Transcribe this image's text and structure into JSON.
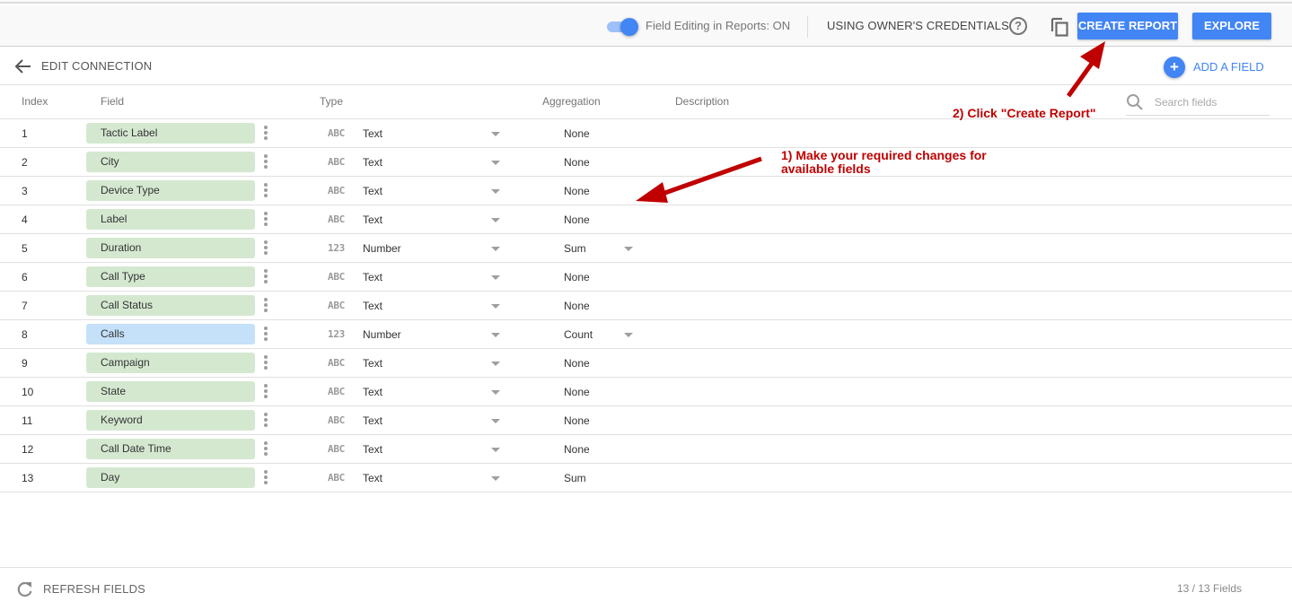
{
  "toolbar": {
    "field_editing_label": "Field Editing in Reports: ON",
    "field_editing_on": true,
    "credentials_label": "USING OWNER'S CREDENTIALS",
    "help_glyph": "?",
    "create_report_label": "CREATE REPORT",
    "explore_label": "EXPLORE"
  },
  "subheader": {
    "back_label": "EDIT CONNECTION",
    "add_field_glyph": "+",
    "add_field_label": "ADD A FIELD"
  },
  "table": {
    "headers": {
      "index": "Index",
      "field": "Field",
      "type": "Type",
      "aggregation": "Aggregation",
      "description": "Description"
    },
    "search_placeholder": "Search fields",
    "rows": [
      {
        "index": "1",
        "field": "Tactic Label",
        "kind": "dimension",
        "type_icon": "ABC",
        "type": "Text",
        "aggregation": "None",
        "agg_dropdown": false
      },
      {
        "index": "2",
        "field": "City",
        "kind": "dimension",
        "type_icon": "ABC",
        "type": "Text",
        "aggregation": "None",
        "agg_dropdown": false
      },
      {
        "index": "3",
        "field": "Device Type",
        "kind": "dimension",
        "type_icon": "ABC",
        "type": "Text",
        "aggregation": "None",
        "agg_dropdown": false
      },
      {
        "index": "4",
        "field": "Label",
        "kind": "dimension",
        "type_icon": "ABC",
        "type": "Text",
        "aggregation": "None",
        "agg_dropdown": false
      },
      {
        "index": "5",
        "field": "Duration",
        "kind": "dimension",
        "type_icon": "123",
        "type": "Number",
        "aggregation": "Sum",
        "agg_dropdown": true
      },
      {
        "index": "6",
        "field": "Call Type",
        "kind": "dimension",
        "type_icon": "ABC",
        "type": "Text",
        "aggregation": "None",
        "agg_dropdown": false
      },
      {
        "index": "7",
        "field": "Call Status",
        "kind": "dimension",
        "type_icon": "ABC",
        "type": "Text",
        "aggregation": "None",
        "agg_dropdown": false
      },
      {
        "index": "8",
        "field": "Calls",
        "kind": "metric",
        "type_icon": "123",
        "type": "Number",
        "aggregation": "Count",
        "agg_dropdown": true
      },
      {
        "index": "9",
        "field": "Campaign",
        "kind": "dimension",
        "type_icon": "ABC",
        "type": "Text",
        "aggregation": "None",
        "agg_dropdown": false
      },
      {
        "index": "10",
        "field": "State",
        "kind": "dimension",
        "type_icon": "ABC",
        "type": "Text",
        "aggregation": "None",
        "agg_dropdown": false
      },
      {
        "index": "11",
        "field": "Keyword",
        "kind": "dimension",
        "type_icon": "ABC",
        "type": "Text",
        "aggregation": "None",
        "agg_dropdown": false
      },
      {
        "index": "12",
        "field": "Call Date Time",
        "kind": "dimension",
        "type_icon": "ABC",
        "type": "Text",
        "aggregation": "None",
        "agg_dropdown": false
      },
      {
        "index": "13",
        "field": "Day",
        "kind": "dimension",
        "type_icon": "ABC",
        "type": "Text",
        "aggregation": "Sum",
        "agg_dropdown": false
      }
    ]
  },
  "footer": {
    "refresh_label": "REFRESH FIELDS",
    "field_count": "13 / 13 Fields"
  },
  "annotations": {
    "step1": "1) Make your required changes for available fields",
    "step2": "2) Click \"Create Report\""
  },
  "colors": {
    "accent": "#4285f4",
    "dimension_chip": "#d4e8d0",
    "metric_chip": "#c5e0f9",
    "annotation": "#c00000"
  }
}
